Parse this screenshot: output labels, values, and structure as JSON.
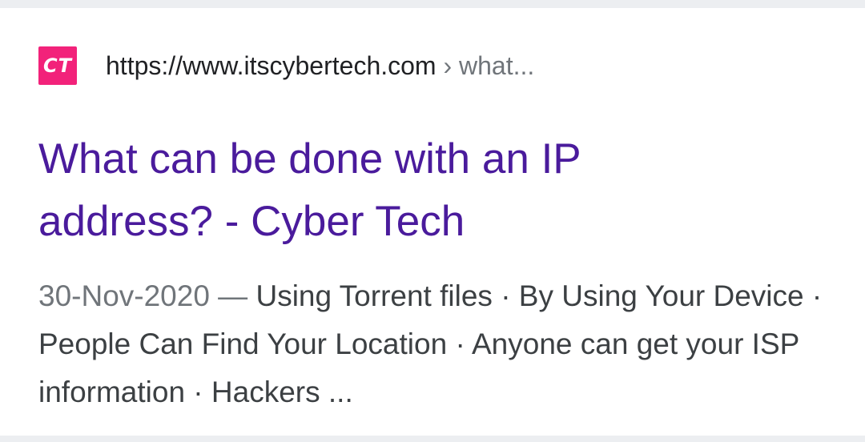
{
  "result": {
    "favicon_text": "CT",
    "favicon_color": "#f2227a",
    "url": "https://www.itscybertech.com",
    "breadcrumb": " › what...",
    "title": "What can be done with an IP address? - Cyber Tech",
    "title_color": "#4a1b9c",
    "date": "30-Nov-2020",
    "separator": " — ",
    "snippet": "Using Torrent files · By Using Your Device · People Can Find Your Location · Anyone can get your ISP information · Hackers  ..."
  }
}
